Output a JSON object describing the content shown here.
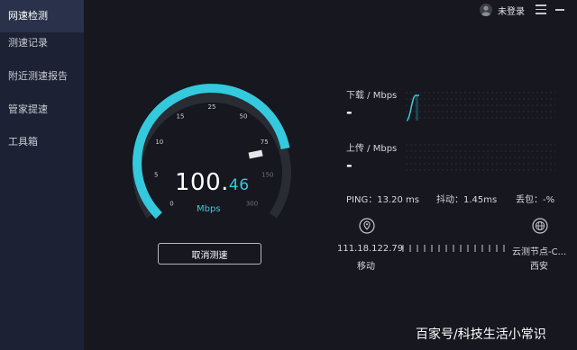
{
  "sidebar": {
    "items": [
      {
        "label": "网速检测"
      },
      {
        "label": "测速记录"
      },
      {
        "label": "附近测速报告"
      },
      {
        "label": "管家提速"
      },
      {
        "label": "工具箱"
      }
    ]
  },
  "header": {
    "login_label": "未登录",
    "user_icon": "user-avatar-icon",
    "menu_icon": "hamburger-menu-icon",
    "minimize_icon": "minimize-icon"
  },
  "gauge": {
    "value_int": "100.",
    "value_dec": "46",
    "unit": "Mbps",
    "reading": 100.46,
    "max": 300,
    "tick_labels": [
      "0",
      "5",
      "10",
      "15",
      "25",
      "50",
      "75",
      "150",
      "300"
    ],
    "accent_color": "#34c9dd"
  },
  "cancel_button": {
    "label": "取消测速"
  },
  "download": {
    "label": "下载 / Mbps",
    "value": "-"
  },
  "upload": {
    "label": "上传 / Mbps",
    "value": "-"
  },
  "stats": {
    "ping": "PING：13.20 ms",
    "jitter": "抖动：1.45ms",
    "loss": "丢包：-%"
  },
  "client": {
    "ip": "111.18.122.79",
    "isp": "移动",
    "icon": "location-pin-icon"
  },
  "server": {
    "node": "云测节点-C...",
    "city": "西安",
    "icon": "globe-icon"
  },
  "watermark": "百家号/科技生活小常识"
}
